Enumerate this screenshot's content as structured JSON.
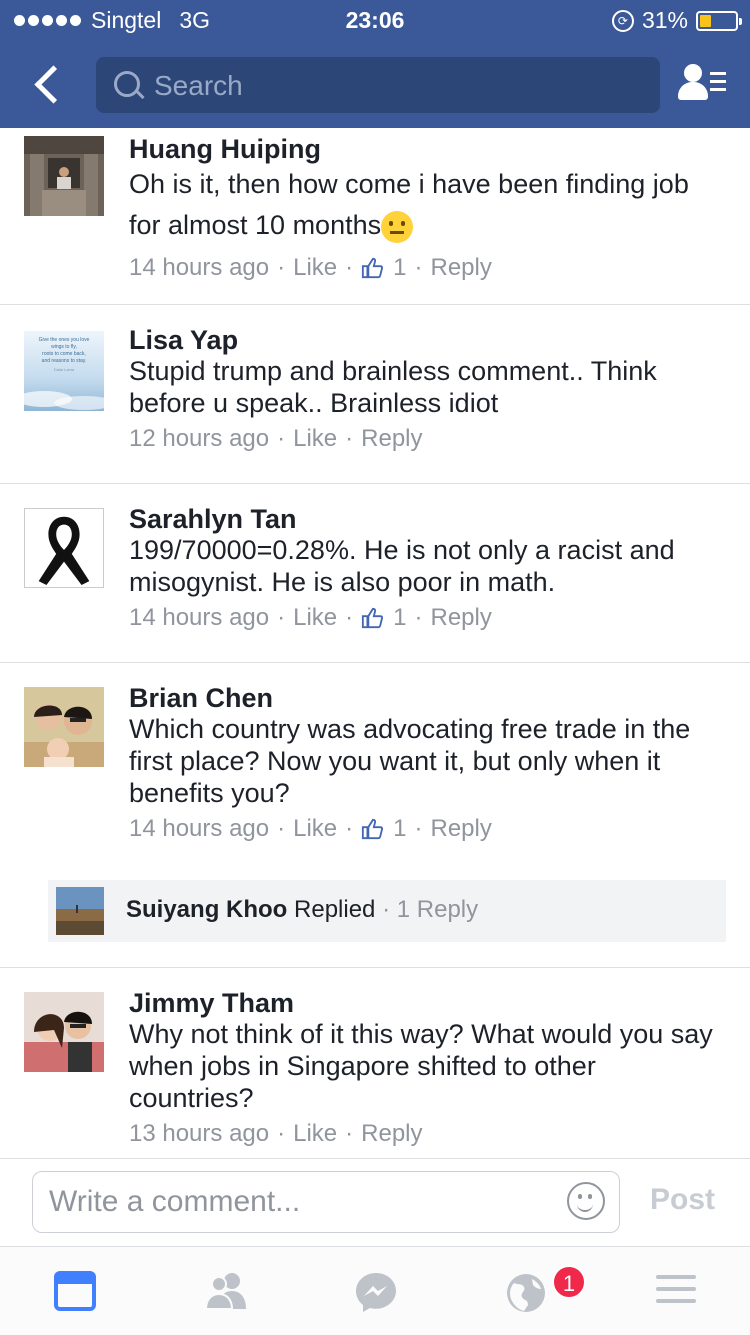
{
  "status_bar": {
    "carrier": "Singtel",
    "network": "3G",
    "time": "23:06",
    "battery": "31%",
    "battery_level": 0.31
  },
  "header": {
    "search_placeholder": "Search"
  },
  "comments": [
    {
      "name": "Huang Huiping",
      "text": "Oh is it, then how come i have been finding job for almost 10 months",
      "emoji": "neutral-face",
      "time": "14 hours ago",
      "like_label": "Like",
      "like_count": "1",
      "reply_label": "Reply"
    },
    {
      "name": "Lisa Yap",
      "text": "Stupid trump and brainless comment.. Think before u speak.. Brainless idiot",
      "time": "12 hours ago",
      "like_label": "Like",
      "reply_label": "Reply",
      "avatar_lines": [
        "Give the ones you love",
        "wings to fly,",
        "roots to come back,",
        "and reasons to stay.",
        "Dalai Lama"
      ]
    },
    {
      "name": "Sarahlyn Tan",
      "text": "199/70000=0.28%. He is not only a racist and misogynist. He is also poor in math.",
      "time": "14 hours ago",
      "like_label": "Like",
      "like_count": "1",
      "reply_label": "Reply"
    },
    {
      "name": "Brian Chen",
      "text": "Which country was advocating free trade in the first place? Now you want it, but only when it benefits you?",
      "time": "14 hours ago",
      "like_label": "Like",
      "like_count": "1",
      "reply_label": "Reply",
      "reply_summary": {
        "name": "Suiyang Khoo",
        "action": "Replied",
        "count": "1 Reply"
      }
    },
    {
      "name": "Jimmy Tham",
      "text": "Why not think of it this way? What would you say when jobs in Singapore shifted to other countries?",
      "time": "13 hours ago",
      "like_label": "Like",
      "reply_label": "Reply"
    }
  ],
  "composer": {
    "placeholder": "Write a comment...",
    "post_label": "Post"
  },
  "tabbar": {
    "notifications_badge": "1",
    "accent": "#4080ff",
    "inactive": "#bec3c9"
  }
}
